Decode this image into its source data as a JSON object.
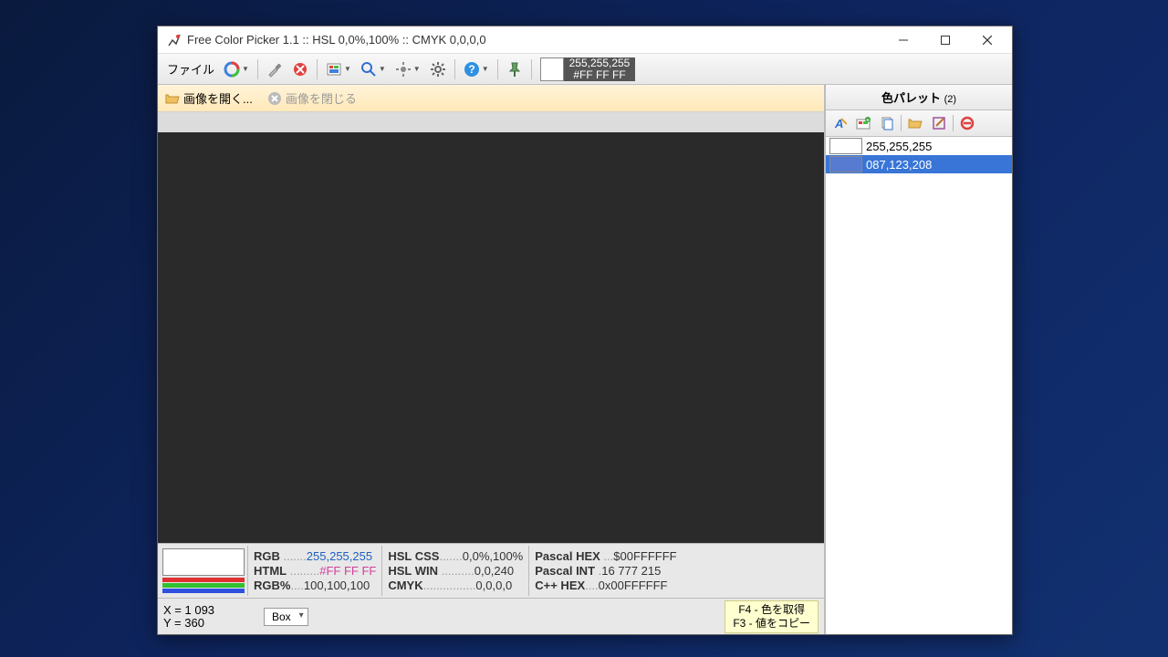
{
  "window": {
    "title": "Free Color Picker 1.1  ::  HSL 0,0%,100%  ::  CMYK 0,0,0,0"
  },
  "toolbar": {
    "file_label": "ファイル",
    "color_rgb": "255,255,255",
    "color_hex": "#FF FF FF"
  },
  "subtoolbar": {
    "open_image": "画像を開く...",
    "close_image": "画像を閉じる"
  },
  "info": {
    "col1": [
      {
        "label": "RGB",
        "dots": " .......",
        "val": "255,255,255",
        "cls": "blue"
      },
      {
        "label": "HTML",
        "dots": " .........",
        "val": "#FF FF FF",
        "cls": "pink"
      },
      {
        "label": "RGB%",
        "dots": "....",
        "val": "100,100,100",
        "cls": ""
      }
    ],
    "col2": [
      {
        "label": "HSL CSS",
        "dots": ".......",
        "val": "0,0%,100%",
        "cls": ""
      },
      {
        "label": "HSL WIN",
        "dots": " ..........",
        "val": "0,0,240",
        "cls": ""
      },
      {
        "label": "CMYK",
        "dots": "................",
        "val": "0,0,0,0",
        "cls": ""
      }
    ],
    "col3": [
      {
        "label": "Pascal HEX",
        "dots": " ...",
        "val": "$00FFFFFF",
        "cls": ""
      },
      {
        "label": "Pascal INT",
        "dots": " .",
        "val": "16 777 215",
        "cls": ""
      },
      {
        "label": "C++ HEX",
        "dots": "....",
        "val": "0x00FFFFFF",
        "cls": ""
      }
    ]
  },
  "status": {
    "x_label": "X = ",
    "x": "1 093",
    "y_label": "Y = ",
    "y": "360",
    "combo": "Box"
  },
  "palette": {
    "title": "色パレット",
    "count": "(2)",
    "items": [
      {
        "color": "#ffffff",
        "label": "255,255,255",
        "selected": false
      },
      {
        "color": "#577bd0",
        "label": "087,123,208",
        "selected": true
      }
    ]
  },
  "hints": {
    "line1": "F4 - 色を取得",
    "line2": "F3 - 値をコピー"
  }
}
